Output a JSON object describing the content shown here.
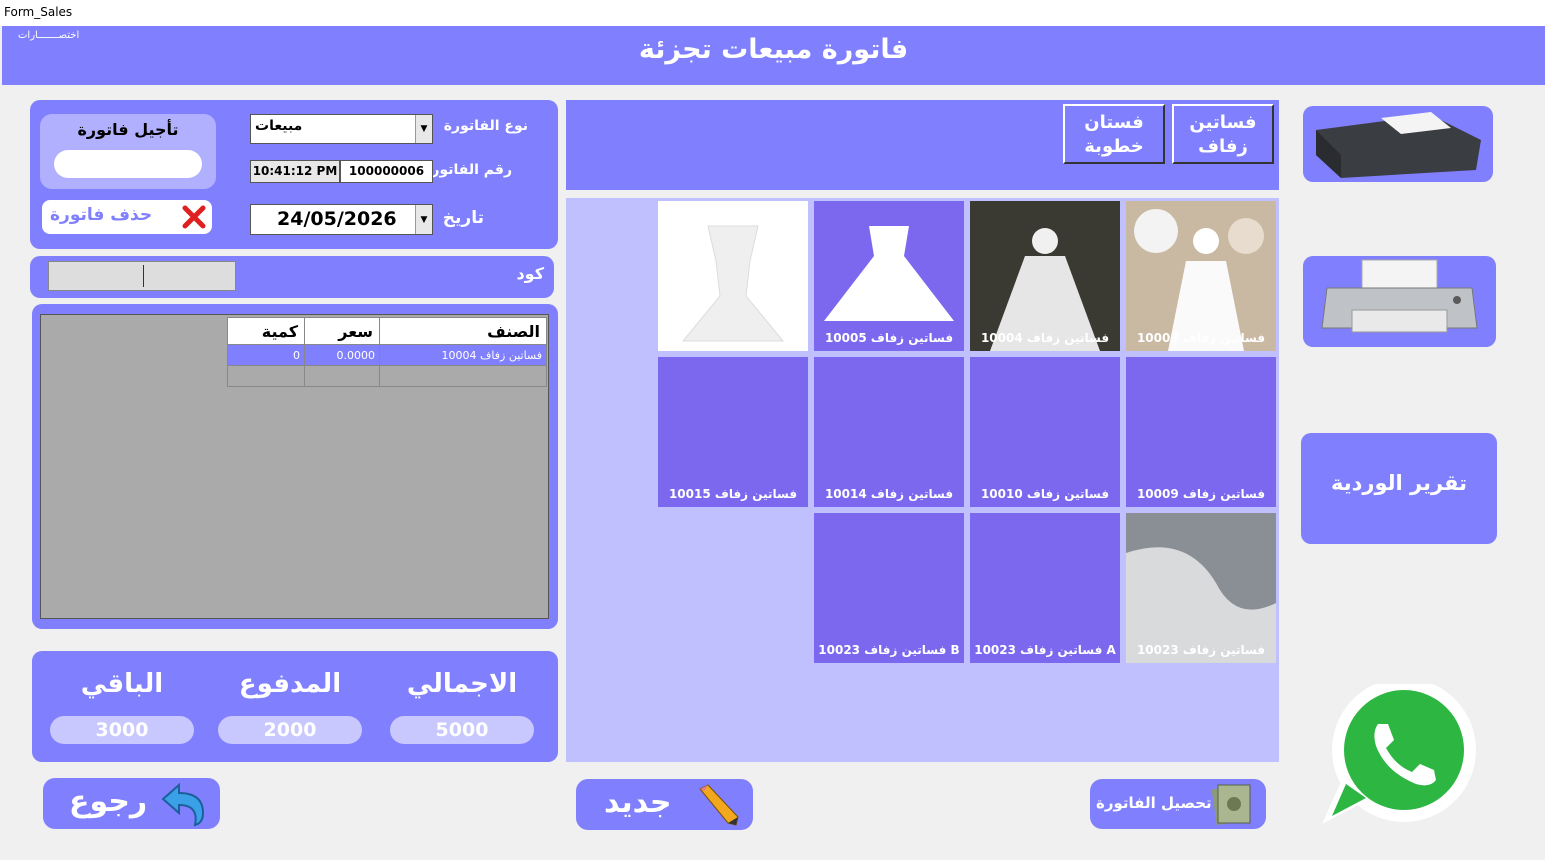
{
  "window": {
    "title": "Form_Sales"
  },
  "header": {
    "title": "فاتورة مبيعات تجزئة",
    "shortcuts": "اختصـــــــارات"
  },
  "invoice": {
    "type_label": "نوع الفاتورة",
    "type_value": "مبيعات",
    "number_label": "رقم الفاتورة",
    "number_value": "100000006",
    "time_value": "10:41:12 PM",
    "date_label": "تاريخ",
    "date_value": "24/05/2026",
    "defer_label": "تأجيل فاتورة",
    "delete_label": "حذف فاتورة"
  },
  "code": {
    "label": "كود"
  },
  "items_table": {
    "columns": [
      "الصنف",
      "سعر",
      "كمية"
    ],
    "rows": [
      {
        "item": "فساتين زفاف 10004",
        "price": "0.0000",
        "qty": "0"
      }
    ]
  },
  "totals": {
    "total_label": "الاجمالي",
    "total_value": "5000",
    "paid_label": "المدفوع",
    "paid_value": "2000",
    "remaining_label": "الباقي",
    "remaining_value": "3000"
  },
  "categories": [
    {
      "label": "فساتين زفاف"
    },
    {
      "label": "فستان خطوبة"
    }
  ],
  "products": [
    {
      "label": "فساتين زفاف 10003"
    },
    {
      "label": "فساتين زفاف 10004"
    },
    {
      "label": "فساتين زفاف 10005"
    },
    {
      "label": ""
    },
    {
      "label": "فساتين زفاف 10009"
    },
    {
      "label": "فساتين زفاف 10010"
    },
    {
      "label": "فساتين زفاف 10014"
    },
    {
      "label": "فساتين زفاف 10015"
    },
    {
      "label": "فساتين زفاف 10023"
    },
    {
      "label": "فساتين زفاف 10023 A"
    },
    {
      "label": "فساتين زفاف 10023 B"
    }
  ],
  "side": {
    "shift_report": "تقرير الوردية"
  },
  "footer": {
    "collect": "تحصيل الفاتورة",
    "new": "جديد",
    "back": "رجوع"
  },
  "colors": {
    "panel": "#8080ff",
    "tile": "#7b68ee",
    "grid_bg": "#c0c0ff"
  }
}
